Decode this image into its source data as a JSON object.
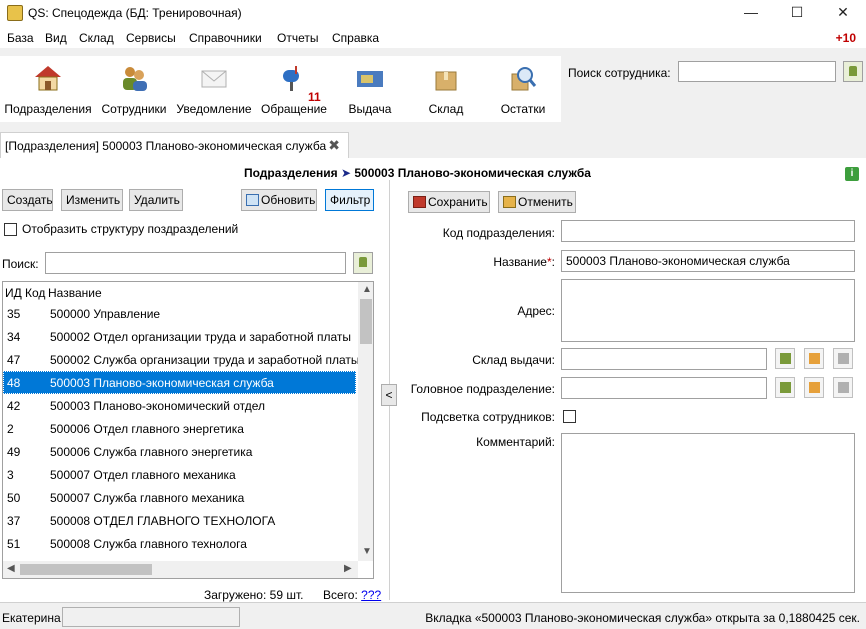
{
  "window": {
    "title": "QS: Спецодежда (БД: Тренировочная)",
    "minimize": "—",
    "maximize": "☐",
    "close": "✕"
  },
  "menu": {
    "items": [
      "База",
      "Вид",
      "Склад",
      "Сервисы",
      "Справочники",
      "Отчеты",
      "Справка"
    ],
    "updates": "+10"
  },
  "toolbar": {
    "buttons": [
      {
        "label": "Подразделения",
        "icon": "house-icon"
      },
      {
        "label": "Сотрудники",
        "icon": "people-icon"
      },
      {
        "label": "Уведомление",
        "icon": "envelope-icon"
      },
      {
        "label": "Обращение",
        "icon": "mailbox-icon",
        "badge": "11"
      },
      {
        "label": "Выдача",
        "icon": "card-icon"
      },
      {
        "label": "Склад",
        "icon": "box-icon"
      },
      {
        "label": "Остатки",
        "icon": "magnifier-icon"
      }
    ],
    "search_label": "Поиск сотрудника:",
    "search_value": ""
  },
  "tab": {
    "label": "[Подразделения] 500003 Планово-экономическая служба",
    "close": "✖"
  },
  "breadcrumb": {
    "section": "Подразделения",
    "arrow": "➤",
    "item": "500003 Планово-экономическая служба"
  },
  "left": {
    "create": "Создать",
    "edit": "Изменить",
    "delete": "Удалить",
    "refresh": "Обновить",
    "filter": "Фильтр",
    "structure_label": "Отобразить структуру поздразделений",
    "search_label": "Поиск:",
    "search_value": "",
    "columns": {
      "id": "ИД",
      "code": "Код",
      "name": "Название"
    },
    "rows": [
      {
        "id": "35",
        "name": "500000 Управление"
      },
      {
        "id": "34",
        "name": "500002 Отдел организации труда и заработной платы"
      },
      {
        "id": "47",
        "name": "500002 Служба организации труда и заработной платы"
      },
      {
        "id": "48",
        "name": "500003 Планово-экономическая служба",
        "selected": true
      },
      {
        "id": "42",
        "name": "500003 Планово-экономический отдел"
      },
      {
        "id": "2",
        "name": "500006 Отдел главного энергетика"
      },
      {
        "id": "49",
        "name": "500006 Служба главного энергетика"
      },
      {
        "id": "3",
        "name": "500007 Отдел главного механика"
      },
      {
        "id": "50",
        "name": "500007 Служба главного механика"
      },
      {
        "id": "37",
        "name": "500008 ОТДЕЛ ГЛАВНОГО ТЕХНОЛОГА"
      },
      {
        "id": "51",
        "name": "500008 Служба главного технолога"
      }
    ],
    "loaded": "Загружено: 59 шт.",
    "total_label": "Всего:",
    "total_value": "???"
  },
  "form": {
    "save": "Сохранить",
    "cancel": "Отменить",
    "code_label": "Код подразделения:",
    "code_value": "",
    "name_label": "Название",
    "required_mark": "*",
    "name_colon": ":",
    "name_value": "500003 Планово-экономическая служба",
    "address_label": "Адрес:",
    "address_value": "",
    "warehouse_label": "Склад выдачи:",
    "warehouse_value": "",
    "parent_label": "Головное подразделение:",
    "parent_value": "",
    "highlight_label": "Подсветка сотрудников:",
    "comment_label": "Комментарий:",
    "comment_value": ""
  },
  "status": {
    "user": "Екатерина",
    "message": "Вкладка «500003 Планово-экономическая служба» открыта за 0,1880425 сек."
  },
  "colors": {
    "selection": "#0078d7",
    "updates": "#c00000",
    "breadcrumb_arrow": "#1b2a8a"
  }
}
